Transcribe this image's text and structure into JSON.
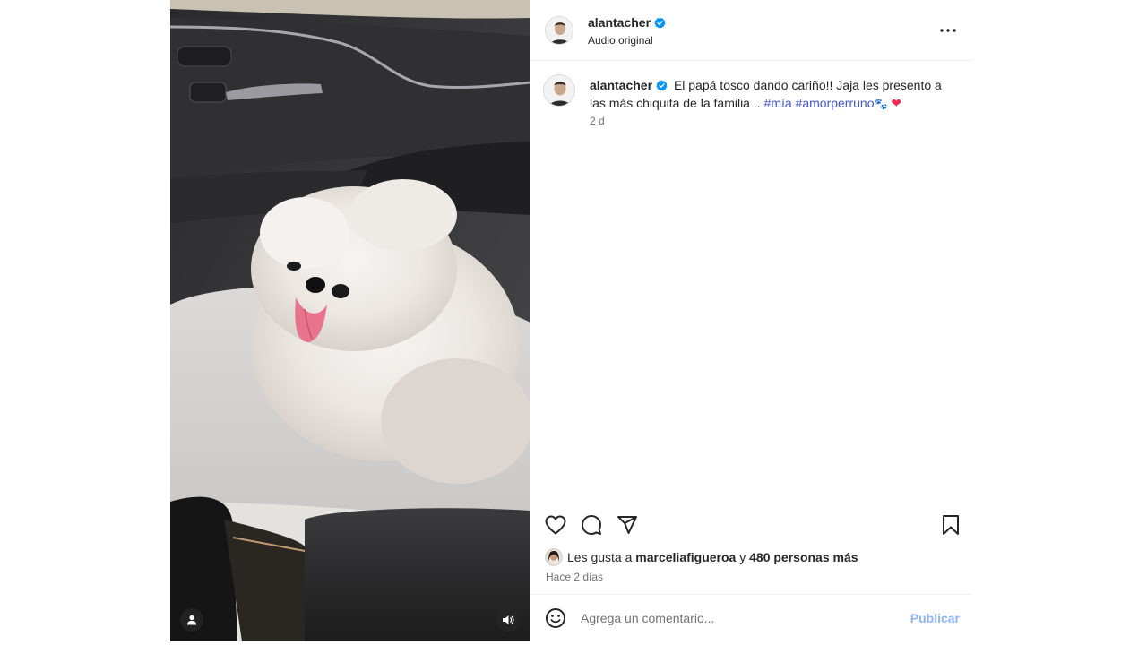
{
  "post": {
    "username": "alantacher",
    "audio_label": "Audio original",
    "caption": {
      "username": "alantacher",
      "text": "El papá tosco dando cariño!! Jaja les presento a las más chiquita de la familia .. ",
      "hashtags": [
        "#mía",
        "#amorperruno"
      ],
      "emojis": [
        "🐾",
        "❤"
      ],
      "time_ago": "2 d"
    },
    "likes": {
      "prefix": "Les gusta a",
      "liker": "marceliafigueroa",
      "joiner": "y",
      "others": "480 personas más"
    },
    "date_label": "Hace 2 días",
    "comment": {
      "placeholder": "Agrega un comentario...",
      "publish_label": "Publicar"
    }
  },
  "icons": {
    "header": [
      "verified-badge-icon",
      "more-options-icon"
    ],
    "actions": [
      "heart-icon",
      "comment-icon",
      "share-icon",
      "bookmark-icon"
    ],
    "media": [
      "user-tag-icon",
      "volume-icon"
    ],
    "comment": [
      "emoji-icon"
    ]
  },
  "colors": {
    "accent_link": "#4456c6",
    "verified": "#0095f6",
    "publish_disabled": "#8fb4f5",
    "secondary_text": "#737373"
  }
}
